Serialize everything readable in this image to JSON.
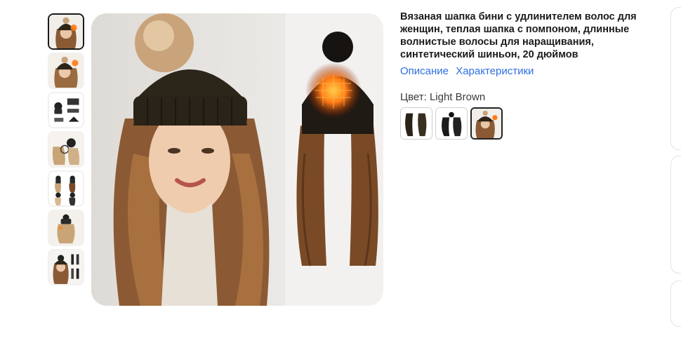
{
  "product": {
    "title": "Вязаная шапка бини с удлинителем волос для женщин, теплая шапка с помпоном, длинные волнистые волосы для наращивания, синтетический шиньон, 20 дюймов"
  },
  "links": {
    "description": "Описание",
    "characteristics": "Характеристики"
  },
  "color": {
    "label": "Цвет: Light Brown",
    "selected_index": 2
  },
  "gallery": {
    "active_index": 0,
    "thumb_count": 7
  },
  "colors": {
    "link": "#2f6fe0",
    "hat": "#2c2519",
    "hair": "#7a4a26",
    "heat": "#ff7a14"
  }
}
